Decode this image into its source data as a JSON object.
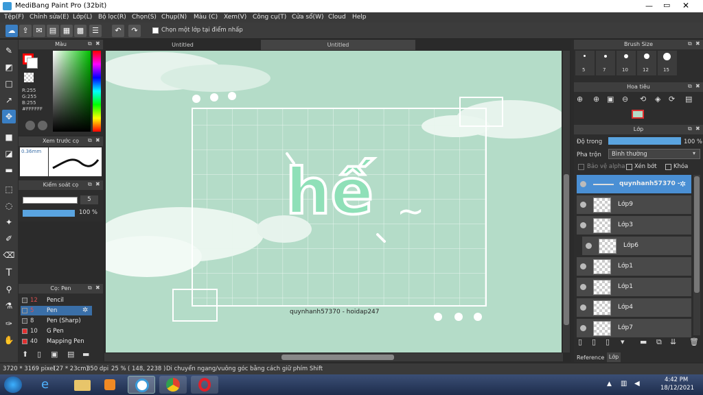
{
  "app": {
    "title": "MediBang Paint Pro (32bit)"
  },
  "menu": [
    "Tệp(F)",
    "Chỉnh sửa(E)",
    "Lớp(L)",
    "Bộ lọc(R)",
    "Chọn(S)",
    "Chụp(N)",
    "Màu (C)",
    "Xem(V)",
    "Công cụ(T)",
    "Cửa sổ(W)",
    "Cloud",
    "Help"
  ],
  "toolbar": {
    "checkbox_label": "Chọn một lớp tại điểm nhấp"
  },
  "color_panel": {
    "title": "Màu",
    "r": "R:255",
    "g": "G:255",
    "b": "B:255",
    "hex": "#FFFFFF",
    "primary": "#ff0000"
  },
  "brush_preview": {
    "title": "Xem trước cọ",
    "size": "0.36mm"
  },
  "brush_control": {
    "title": "Kiểm soát cọ",
    "size_value": "5",
    "opacity_value": "100 %"
  },
  "brush_list": {
    "title": "Cọ: Pen",
    "items": [
      {
        "num": "12",
        "name": "Pencil",
        "color": "#444444"
      },
      {
        "num": "5",
        "name": "Pen",
        "color": "#3a6fa8",
        "selected": true
      },
      {
        "num": "8",
        "name": "Pen (Sharp)",
        "color": "#444444"
      },
      {
        "num": "10",
        "name": "G Pen",
        "color": "#e03030"
      },
      {
        "num": "40",
        "name": "Mapping Pen",
        "color": "#e03030"
      }
    ]
  },
  "documents": {
    "tabs": [
      "Untitled",
      "Untitled"
    ]
  },
  "artwork": {
    "main_text": "hế",
    "tilde": "~",
    "credit": "quynhanh57370 - hoidap247",
    "bg": "#b4dcc8"
  },
  "brush_size": {
    "title": "Brush Size",
    "sizes": [
      "5",
      "7",
      "10",
      "12",
      "15"
    ]
  },
  "navigator": {
    "title": "Hoa tiêu"
  },
  "layers": {
    "title": "Lớp",
    "opacity_label": "Độ trong",
    "opacity_value": "100 %",
    "blend_label": "Pha trộn",
    "blend_value": "Bình thường",
    "protect_alpha": "Bảo vệ alpha",
    "clip": "Xén bớt",
    "lock": "Khóa",
    "items": [
      "quynhanh57370 -",
      "Lớp9",
      "Lớp3",
      "Lớp6",
      "Lớp1",
      "Lớp1",
      "Lớp4",
      "Lớp7"
    ]
  },
  "bottom_tabs": [
    "Reference",
    "Lớp"
  ],
  "status": {
    "dims": "3720 * 3169 pixel",
    "cm": "(27 * 23cm)",
    "dpi": "350 dpi",
    "zoom": "25 %",
    "coords": "( 148, 2238 )",
    "hint": "Di chuyển ngang/vuông góc bằng cách giữ phím Shift"
  },
  "taskbar": {
    "time": "4:42 PM",
    "date": "18/12/2021"
  }
}
